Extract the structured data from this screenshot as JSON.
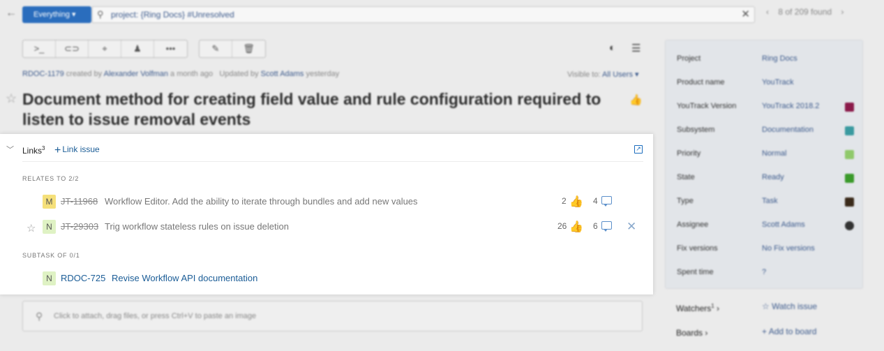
{
  "topbar": {
    "back_icon": "arrow-left-icon",
    "scope_label": "Everything ▾",
    "search_query": "project: {Ring Docs} #Unresolved",
    "pager_text": "8 of 209 found"
  },
  "issue": {
    "id": "RDOC-1179",
    "created_prefix": "created by",
    "created_by": "Alexander Volfman",
    "created_when": "a month ago",
    "updated_prefix": "Updated by",
    "updated_by": "Scott Adams",
    "updated_when": "yesterday",
    "visible_prefix": "Visible to:",
    "visible_to": "All Users ▾",
    "title": "Document method for creating field value and rule configuration required to listen to issue removal events"
  },
  "fields": [
    {
      "name": "Project",
      "value": "Ring Docs",
      "color": ""
    },
    {
      "name": "Product name",
      "value": "YouTrack",
      "color": ""
    },
    {
      "name": "YouTrack Version",
      "value": "YouTrack 2018.2",
      "color": "#8b1a4a"
    },
    {
      "name": "Subsystem",
      "value": "Documentation",
      "color": "#3a9aa0"
    },
    {
      "name": "Priority",
      "value": "Normal",
      "color": "#8fc96a"
    },
    {
      "name": "State",
      "value": "Ready",
      "color": "#3a9a2a"
    },
    {
      "name": "Type",
      "value": "Task",
      "color": "#3a2a1a"
    },
    {
      "name": "Assignee",
      "value": "Scott Adams",
      "color": ""
    },
    {
      "name": "Fix versions",
      "value": "No Fix versions",
      "color": ""
    },
    {
      "name": "Spent time",
      "value": "?",
      "color": ""
    }
  ],
  "watchers": {
    "label": "Watchers",
    "count": "1",
    "action": "Watch issue"
  },
  "boards": {
    "label": "Boards",
    "action": "Add to board"
  },
  "attach_hint": "Click to attach, drag files, or press Ctrl+V to paste an image",
  "links": {
    "label": "Links",
    "count": "3",
    "add_label": "Link issue",
    "groups": [
      {
        "label": "RELATES TO 2/2",
        "items": [
          {
            "badge": "M",
            "badge_color": "#f5e07a",
            "id": "JT-11968",
            "summary": "Workflow Editor. Add the ability to iterate through bundles and add new values",
            "votes": "2",
            "comments": "4",
            "resolved": true,
            "voted": false
          },
          {
            "badge": "N",
            "badge_color": "#dff2c4",
            "id": "JT-29303",
            "summary": "Trig workflow stateless rules on issue deletion",
            "votes": "26",
            "comments": "6",
            "resolved": true,
            "voted": true
          }
        ]
      },
      {
        "label": "SUBTASK OF 0/1",
        "items": [
          {
            "badge": "N",
            "badge_color": "#dff2c4",
            "id": "RDOC-725",
            "summary": "Revise Workflow API documentation",
            "resolved": false
          }
        ]
      }
    ]
  },
  "colors": {
    "accent": "#1a5c96",
    "voted_thumb": "#e0187a",
    "thumb": "#3c6fae"
  }
}
